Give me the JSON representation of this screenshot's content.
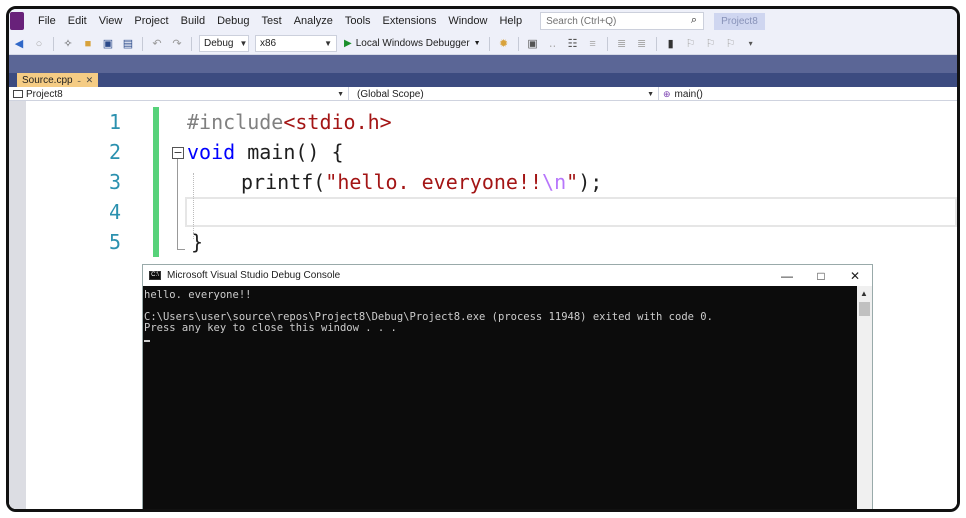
{
  "menu": {
    "items": [
      "File",
      "Edit",
      "View",
      "Project",
      "Build",
      "Debug",
      "Test",
      "Analyze",
      "Tools",
      "Extensions",
      "Window",
      "Help"
    ],
    "search_placeholder": "Search (Ctrl+Q)",
    "project_name": "Project8"
  },
  "toolbar": {
    "config": "Debug",
    "platform": "x86",
    "debugger": "Local Windows Debugger"
  },
  "tab": {
    "file": "Source.cpp"
  },
  "navbar": {
    "project": "Project8",
    "scope": "(Global Scope)",
    "member": "main()"
  },
  "editor": {
    "line_numbers": [
      "1",
      "2",
      "3",
      "4",
      "5"
    ],
    "line1": {
      "directive": "#include",
      "header": "<stdio.h>"
    },
    "line2": {
      "keyword": "void",
      "rest": " main() {"
    },
    "line3": {
      "func": "printf(",
      "str1": "\"hello. everyone!!",
      "escape": "\\n",
      "str2": "\"",
      "end": ");"
    },
    "line5": {
      "text": "}"
    }
  },
  "console": {
    "title": "Microsoft Visual Studio Debug Console",
    "line1": "hello. everyone!!",
    "line2": "",
    "line3": "C:\\Users\\user\\source\\repos\\Project8\\Debug\\Project8.exe (process 11948) exited with code 0.",
    "line4": "Press any key to close this window . . ."
  }
}
